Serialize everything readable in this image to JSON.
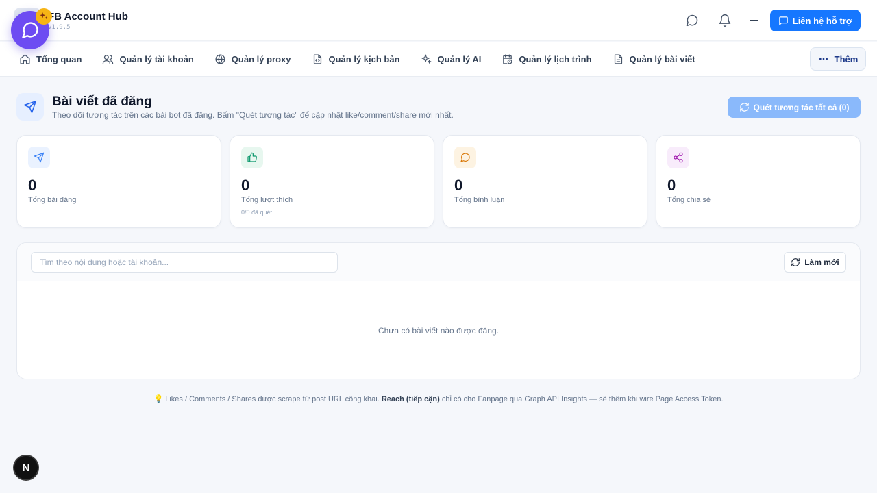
{
  "app": {
    "title": "FB Account Hub",
    "version": "v1.9.5"
  },
  "header": {
    "support_label": "Liên hệ hỗ trợ"
  },
  "nav": {
    "items": [
      {
        "label": "Tổng quan",
        "icon": "home-icon"
      },
      {
        "label": "Quản lý tài khoản",
        "icon": "users-icon"
      },
      {
        "label": "Quản lý proxy",
        "icon": "globe-icon"
      },
      {
        "label": "Quản lý kịch bản",
        "icon": "script-file-icon"
      },
      {
        "label": "Quản lý AI",
        "icon": "sparkles-icon"
      },
      {
        "label": "Quản lý lịch trình",
        "icon": "calendar-clock-icon"
      },
      {
        "label": "Quản lý bài viết",
        "icon": "document-icon"
      }
    ],
    "more_label": "Thêm"
  },
  "page": {
    "title": "Bài viết đã đăng",
    "subtitle": "Theo dõi tương tác trên các bài bot đã đăng. Bấm \"Quét tương tác\" để cập nhật like/comment/share mới nhất.",
    "scan_all_label": "Quét tương tác tất cả (0)"
  },
  "stats": [
    {
      "value": "0",
      "label": "Tổng bài đăng",
      "icon": "send-icon",
      "color": "#3b82f6",
      "bg": "#eaf2ff"
    },
    {
      "value": "0",
      "label": "Tổng lượt thích",
      "sub": "0/0 đã quét",
      "icon": "thumbs-up-icon",
      "color": "#059669",
      "bg": "#e7f7ef"
    },
    {
      "value": "0",
      "label": "Tổng bình luận",
      "icon": "comment-icon",
      "color": "#d97706",
      "bg": "#fdf3e2"
    },
    {
      "value": "0",
      "label": "Tổng chia sẻ",
      "icon": "share-icon",
      "color": "#a21caf",
      "bg": "#f8ecfb"
    }
  ],
  "posts": {
    "search_placeholder": "Tìm theo nội dung hoặc tài khoản...",
    "refresh_label": "Làm mới",
    "empty_message": "Chưa có bài viết nào được đăng."
  },
  "footnote": {
    "part1": "Likes / Comments / Shares được scrape từ post URL công khai. ",
    "bold": "Reach (tiếp cận)",
    "part2": " chỉ có cho Fanpage qua Graph API Insights — sẽ thêm khi wire Page Access Token."
  },
  "dev_badge": "N",
  "colors": {
    "primary": "#1677ff",
    "chat_bubble": "#6d4cf2",
    "badge": "#f6b415"
  }
}
